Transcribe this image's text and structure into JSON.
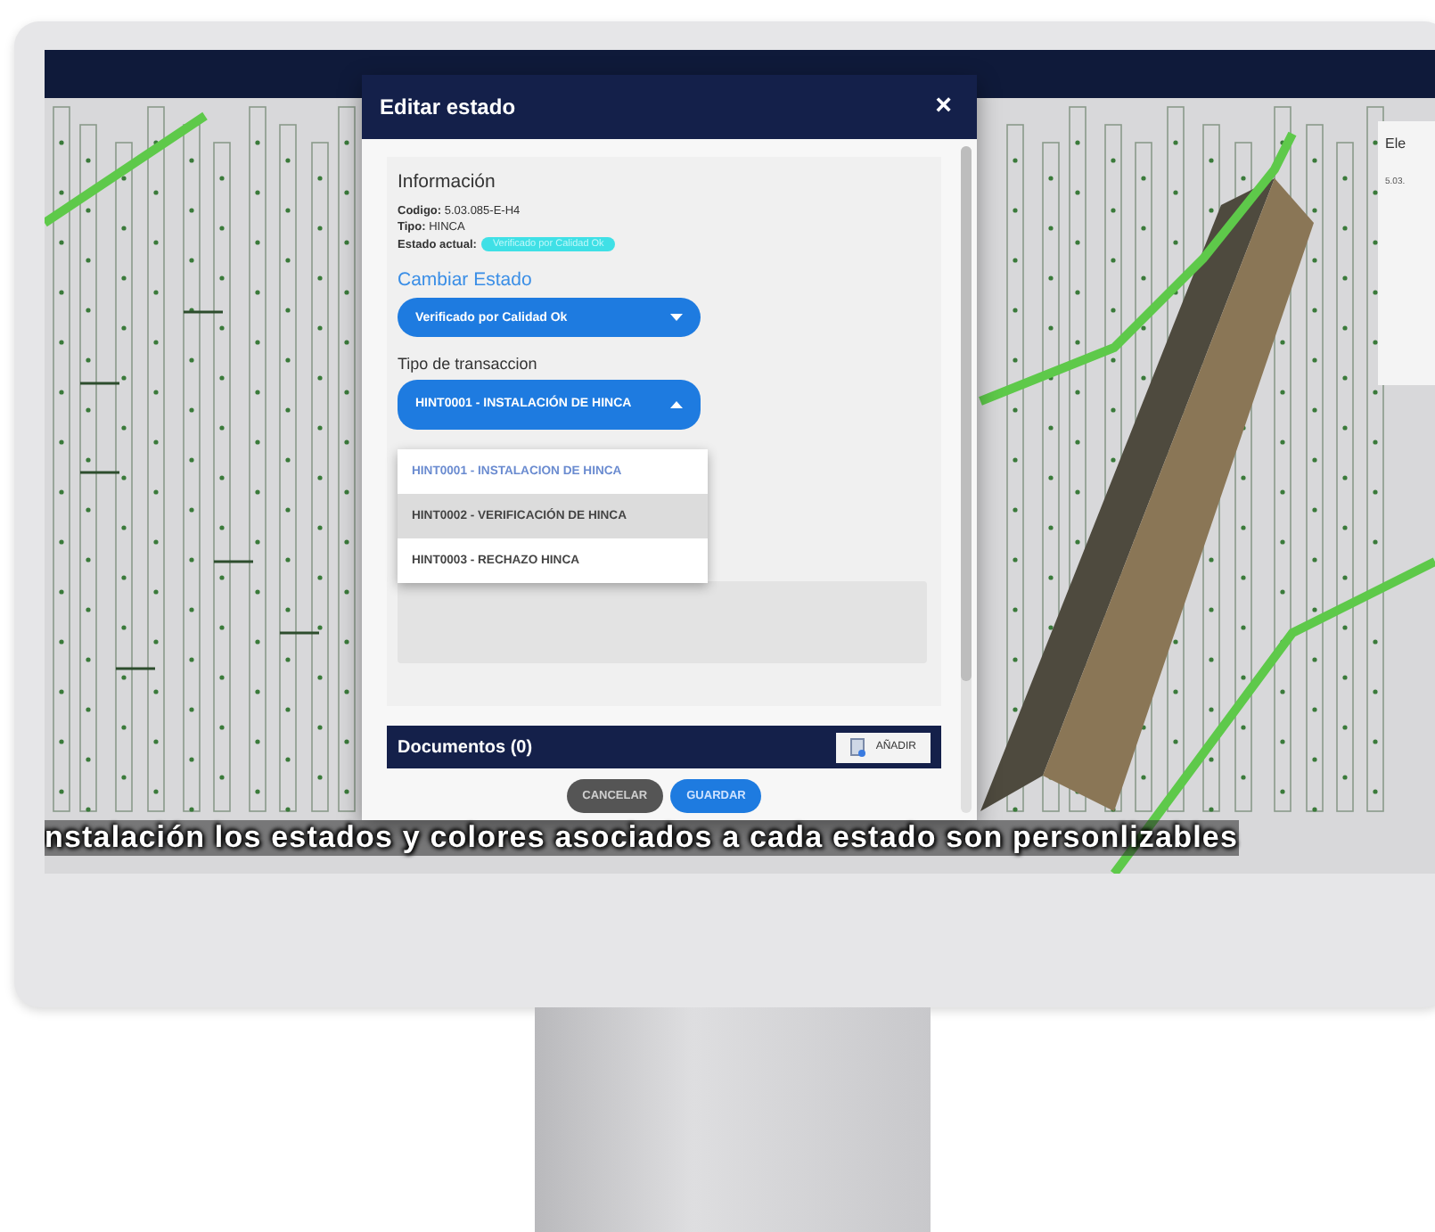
{
  "dialog": {
    "title": "Editar estado",
    "close": "×",
    "section_title": "Información",
    "fields": [
      {
        "label": "Codigo:",
        "value": "5.03.085-E-H4"
      },
      {
        "label": "Tipo:",
        "value": "HINCA"
      }
    ],
    "current_state": {
      "label": "Estado actual:",
      "badge": "Verificado por Calidad Ok",
      "color": "#3fe0e6"
    },
    "change_state": {
      "heading": "Cambiar Estado",
      "value": "Verificado por Calidad Ok"
    },
    "transaction": {
      "label": "Tipo de transaccion",
      "value": "HINT0001 - INSTALACIÓN DE HINCA",
      "expanded": true,
      "options": [
        {
          "label": "HINT0001 - INSTALACION DE HINCA",
          "selected": true,
          "hovered": false
        },
        {
          "label": "HINT0002 - VERIFICACIÓN DE HINCA",
          "selected": false,
          "hovered": true
        },
        {
          "label": "HINT0003 - RECHAZO HINCA",
          "selected": false,
          "hovered": false
        }
      ]
    },
    "documents": {
      "title": "Documentos (0)",
      "add_button": "AÑADIR"
    },
    "buttons": [
      {
        "label": "CANCELAR",
        "kind": "secondary"
      },
      {
        "label": "GUARDAR",
        "kind": "primary"
      }
    ]
  },
  "side_panel": {
    "title": "Ele",
    "code": "5.03."
  },
  "subtitle": "nstalación los estados y colores asociados a cada estado son personlizables"
}
